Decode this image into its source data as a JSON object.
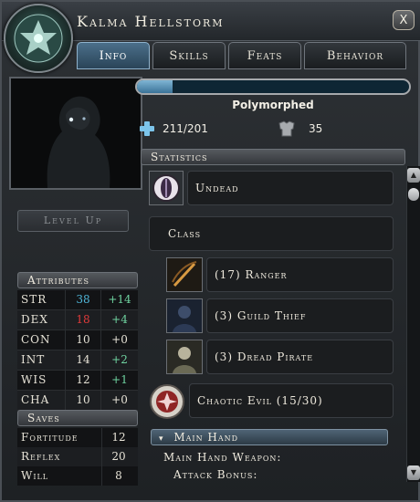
{
  "window": {
    "title": "Kalma Hellstorm",
    "close_label": "X"
  },
  "tabs": [
    {
      "label": "Info",
      "active": true
    },
    {
      "label": "Skills",
      "active": false
    },
    {
      "label": "Feats",
      "active": false
    },
    {
      "label": "Behavior",
      "active": false
    }
  ],
  "left": {
    "level_up_label": "Level Up",
    "attributes_header": "Attributes",
    "attributes": [
      {
        "name": "STR",
        "value": "38",
        "mod": "+14",
        "value_color": "#4fb6d9",
        "mod_color": "#6fd3a0"
      },
      {
        "name": "DEX",
        "value": "18",
        "mod": "+4",
        "value_color": "#e23a3a",
        "mod_color": "#6fd3a0"
      },
      {
        "name": "CON",
        "value": "10",
        "mod": "+0",
        "value_color": "#e6e2d6",
        "mod_color": "#e6e2d6"
      },
      {
        "name": "INT",
        "value": "14",
        "mod": "+2",
        "value_color": "#e6e2d6",
        "mod_color": "#6fd3a0"
      },
      {
        "name": "WIS",
        "value": "12",
        "mod": "+1",
        "value_color": "#e6e2d6",
        "mod_color": "#6fd3a0"
      },
      {
        "name": "CHA",
        "value": "10",
        "mod": "+0",
        "value_color": "#e6e2d6",
        "mod_color": "#e6e2d6"
      }
    ],
    "saves_header": "Saves",
    "saves": [
      {
        "name": "Fortitude",
        "value": "12"
      },
      {
        "name": "Reflex",
        "value": "20"
      },
      {
        "name": "Will",
        "value": "8"
      }
    ]
  },
  "status": {
    "hp_fill_fraction": 0.13,
    "condition": "Polymorphed",
    "hp_text": "211/201",
    "ac_text": "35"
  },
  "statistics": {
    "header": "Statistics",
    "race": "Undead",
    "class_header": "Class",
    "classes": [
      {
        "label": "(17) Ranger",
        "icon": "bow-icon"
      },
      {
        "label": "(3) Guild Thief",
        "icon": "thief-portrait-icon"
      },
      {
        "label": "(3) Dread Pirate",
        "icon": "pirate-portrait-icon"
      }
    ],
    "alignment": "Chaotic Evil (15/30)",
    "main_hand_header": "Main Hand",
    "main_hand_weapon_label": "Main Hand Weapon:",
    "attack_bonus_label": "Attack Bonus:"
  },
  "colors": {
    "accent": "#4b6f8a",
    "hp_bar": "#3b7398"
  }
}
